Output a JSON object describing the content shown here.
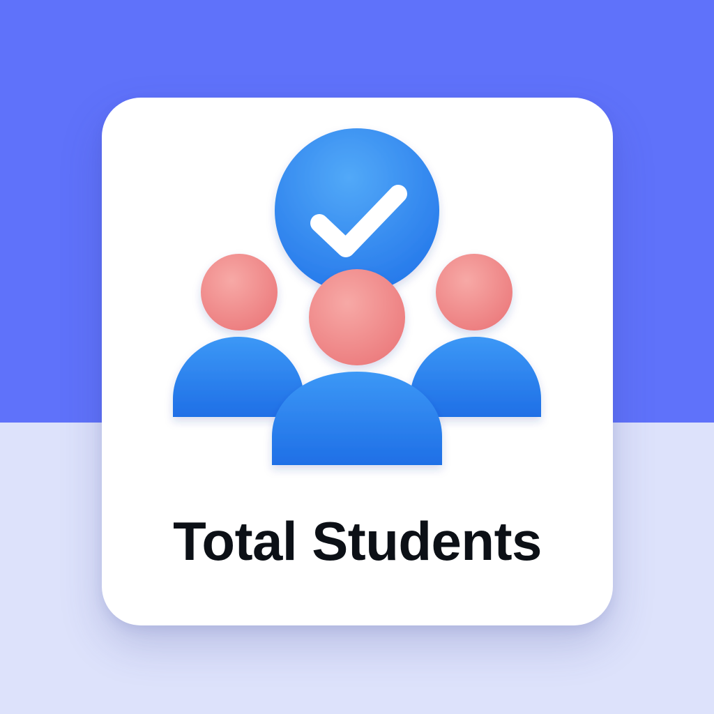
{
  "card": {
    "title": "Total Students",
    "icon": "students-verified-icon"
  },
  "colors": {
    "background_top": "#5f72fa",
    "background_bottom": "#dde2fb",
    "card": "#ffffff",
    "text": "#0c1016",
    "person_body": "#2f87f2",
    "person_head": "#f08a8a",
    "badge": "#3f95f2",
    "check": "#ffffff"
  }
}
